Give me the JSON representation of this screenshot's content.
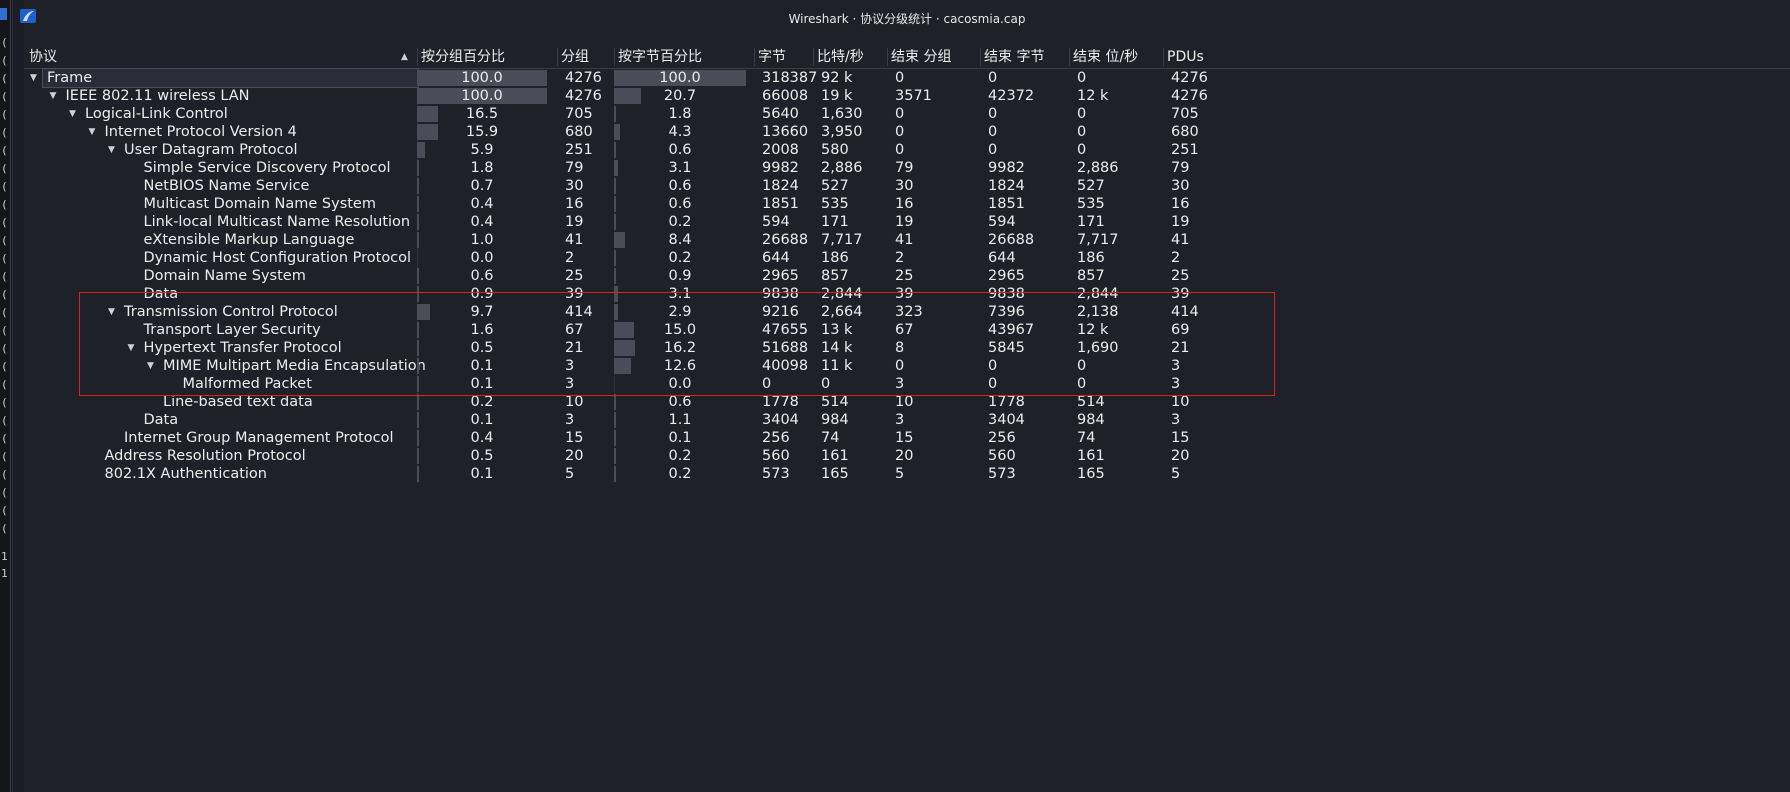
{
  "window": {
    "title": "Wireshark · 协议分级统计 · cacosmia.cap"
  },
  "left_strip": {
    "chars": [
      "(",
      "(",
      "(",
      "(",
      "(",
      "(",
      "(",
      "(",
      "(",
      "(",
      "(",
      "(",
      "(",
      "(",
      "(",
      "(",
      "(",
      "(",
      "(",
      "(",
      "(",
      "(",
      "(",
      "(",
      "(",
      "(",
      "(",
      "(",
      "1",
      "1"
    ]
  },
  "columns": [
    "协议",
    "按分组百分比",
    "分组",
    "按字节百分比",
    "字节",
    "比特/秒",
    "结束 分组",
    "结束 字节",
    "结束 位/秒",
    "PDUs"
  ],
  "rows": [
    {
      "depth": 0,
      "expanded": true,
      "protocol": "Frame",
      "pkt_pct": "100.0",
      "pkts": "4276",
      "byte_pct": "100.0",
      "bytes": "318387",
      "bps": "92 k",
      "end_pkts": "0",
      "end_bytes": "0",
      "end_bps": "0",
      "pdus": "4276",
      "pkt_frac": 1.0,
      "byte_frac": 1.0,
      "selected": true
    },
    {
      "depth": 1,
      "expanded": true,
      "protocol": "IEEE 802.11 wireless LAN",
      "pkt_pct": "100.0",
      "pkts": "4276",
      "byte_pct": "20.7",
      "bytes": "66008",
      "bps": "19 k",
      "end_pkts": "3571",
      "end_bytes": "42372",
      "end_bps": "12 k",
      "pdus": "4276",
      "pkt_frac": 1.0,
      "byte_frac": 0.207
    },
    {
      "depth": 2,
      "expanded": true,
      "protocol": "Logical-Link Control",
      "pkt_pct": "16.5",
      "pkts": "705",
      "byte_pct": "1.8",
      "bytes": "5640",
      "bps": "1,630",
      "end_pkts": "0",
      "end_bytes": "0",
      "end_bps": "0",
      "pdus": "705",
      "pkt_frac": 0.165,
      "byte_frac": 0.018
    },
    {
      "depth": 3,
      "expanded": true,
      "protocol": "Internet Protocol Version 4",
      "pkt_pct": "15.9",
      "pkts": "680",
      "byte_pct": "4.3",
      "bytes": "13660",
      "bps": "3,950",
      "end_pkts": "0",
      "end_bytes": "0",
      "end_bps": "0",
      "pdus": "680",
      "pkt_frac": 0.159,
      "byte_frac": 0.043
    },
    {
      "depth": 4,
      "expanded": true,
      "protocol": "User Datagram Protocol",
      "pkt_pct": "5.9",
      "pkts": "251",
      "byte_pct": "0.6",
      "bytes": "2008",
      "bps": "580",
      "end_pkts": "0",
      "end_bytes": "0",
      "end_bps": "0",
      "pdus": "251",
      "pkt_frac": 0.059,
      "byte_frac": 0.006
    },
    {
      "depth": 5,
      "protocol": "Simple Service Discovery Protocol",
      "pkt_pct": "1.8",
      "pkts": "79",
      "byte_pct": "3.1",
      "bytes": "9982",
      "bps": "2,886",
      "end_pkts": "79",
      "end_bytes": "9982",
      "end_bps": "2,886",
      "pdus": "79",
      "pkt_frac": 0.018,
      "byte_frac": 0.031
    },
    {
      "depth": 5,
      "protocol": "NetBIOS Name Service",
      "pkt_pct": "0.7",
      "pkts": "30",
      "byte_pct": "0.6",
      "bytes": "1824",
      "bps": "527",
      "end_pkts": "30",
      "end_bytes": "1824",
      "end_bps": "527",
      "pdus": "30",
      "pkt_frac": 0.007,
      "byte_frac": 0.006
    },
    {
      "depth": 5,
      "protocol": "Multicast Domain Name System",
      "pkt_pct": "0.4",
      "pkts": "16",
      "byte_pct": "0.6",
      "bytes": "1851",
      "bps": "535",
      "end_pkts": "16",
      "end_bytes": "1851",
      "end_bps": "535",
      "pdus": "16",
      "pkt_frac": 0.004,
      "byte_frac": 0.006
    },
    {
      "depth": 5,
      "protocol": "Link-local Multicast Name Resolution",
      "pkt_pct": "0.4",
      "pkts": "19",
      "byte_pct": "0.2",
      "bytes": "594",
      "bps": "171",
      "end_pkts": "19",
      "end_bytes": "594",
      "end_bps": "171",
      "pdus": "19",
      "pkt_frac": 0.004,
      "byte_frac": 0.002
    },
    {
      "depth": 5,
      "protocol": "eXtensible Markup Language",
      "pkt_pct": "1.0",
      "pkts": "41",
      "byte_pct": "8.4",
      "bytes": "26688",
      "bps": "7,717",
      "end_pkts": "41",
      "end_bytes": "26688",
      "end_bps": "7,717",
      "pdus": "41",
      "pkt_frac": 0.01,
      "byte_frac": 0.084
    },
    {
      "depth": 5,
      "protocol": "Dynamic Host Configuration Protocol",
      "pkt_pct": "0.0",
      "pkts": "2",
      "byte_pct": "0.2",
      "bytes": "644",
      "bps": "186",
      "end_pkts": "2",
      "end_bytes": "644",
      "end_bps": "186",
      "pdus": "2",
      "pkt_frac": 0.0,
      "byte_frac": 0.002
    },
    {
      "depth": 5,
      "protocol": "Domain Name System",
      "pkt_pct": "0.6",
      "pkts": "25",
      "byte_pct": "0.9",
      "bytes": "2965",
      "bps": "857",
      "end_pkts": "25",
      "end_bytes": "2965",
      "end_bps": "857",
      "pdus": "25",
      "pkt_frac": 0.006,
      "byte_frac": 0.009
    },
    {
      "depth": 5,
      "protocol": "Data",
      "pkt_pct": "0.9",
      "pkts": "39",
      "byte_pct": "3.1",
      "bytes": "9838",
      "bps": "2,844",
      "end_pkts": "39",
      "end_bytes": "9838",
      "end_bps": "2,844",
      "pdus": "39",
      "pkt_frac": 0.009,
      "byte_frac": 0.031
    },
    {
      "depth": 4,
      "expanded": true,
      "protocol": "Transmission Control Protocol",
      "pkt_pct": "9.7",
      "pkts": "414",
      "byte_pct": "2.9",
      "bytes": "9216",
      "bps": "2,664",
      "end_pkts": "323",
      "end_bytes": "7396",
      "end_bps": "2,138",
      "pdus": "414",
      "pkt_frac": 0.097,
      "byte_frac": 0.029
    },
    {
      "depth": 5,
      "protocol": "Transport Layer Security",
      "pkt_pct": "1.6",
      "pkts": "67",
      "byte_pct": "15.0",
      "bytes": "47655",
      "bps": "13 k",
      "end_pkts": "67",
      "end_bytes": "43967",
      "end_bps": "12 k",
      "pdus": "69",
      "pkt_frac": 0.016,
      "byte_frac": 0.15
    },
    {
      "depth": 5,
      "expanded": true,
      "protocol": "Hypertext Transfer Protocol",
      "pkt_pct": "0.5",
      "pkts": "21",
      "byte_pct": "16.2",
      "bytes": "51688",
      "bps": "14 k",
      "end_pkts": "8",
      "end_bytes": "5845",
      "end_bps": "1,690",
      "pdus": "21",
      "pkt_frac": 0.005,
      "byte_frac": 0.162
    },
    {
      "depth": 6,
      "expanded": true,
      "protocol": "MIME Multipart Media Encapsulation",
      "pkt_pct": "0.1",
      "pkts": "3",
      "byte_pct": "12.6",
      "bytes": "40098",
      "bps": "11 k",
      "end_pkts": "0",
      "end_bytes": "0",
      "end_bps": "0",
      "pdus": "3",
      "pkt_frac": 0.001,
      "byte_frac": 0.126
    },
    {
      "depth": 7,
      "protocol": "Malformed Packet",
      "pkt_pct": "0.1",
      "pkts": "3",
      "byte_pct": "0.0",
      "bytes": "0",
      "bps": "0",
      "end_pkts": "3",
      "end_bytes": "0",
      "end_bps": "0",
      "pdus": "3",
      "pkt_frac": 0.001,
      "byte_frac": 0.0
    },
    {
      "depth": 6,
      "protocol": "Line-based text data",
      "pkt_pct": "0.2",
      "pkts": "10",
      "byte_pct": "0.6",
      "bytes": "1778",
      "bps": "514",
      "end_pkts": "10",
      "end_bytes": "1778",
      "end_bps": "514",
      "pdus": "10",
      "pkt_frac": 0.002,
      "byte_frac": 0.006
    },
    {
      "depth": 5,
      "protocol": "Data",
      "pkt_pct": "0.1",
      "pkts": "3",
      "byte_pct": "1.1",
      "bytes": "3404",
      "bps": "984",
      "end_pkts": "3",
      "end_bytes": "3404",
      "end_bps": "984",
      "pdus": "3",
      "pkt_frac": 0.001,
      "byte_frac": 0.011
    },
    {
      "depth": 4,
      "protocol": "Internet Group Management Protocol",
      "pkt_pct": "0.4",
      "pkts": "15",
      "byte_pct": "0.1",
      "bytes": "256",
      "bps": "74",
      "end_pkts": "15",
      "end_bytes": "256",
      "end_bps": "74",
      "pdus": "15",
      "pkt_frac": 0.004,
      "byte_frac": 0.001
    },
    {
      "depth": 3,
      "protocol": "Address Resolution Protocol",
      "pkt_pct": "0.5",
      "pkts": "20",
      "byte_pct": "0.2",
      "bytes": "560",
      "bps": "161",
      "end_pkts": "20",
      "end_bytes": "560",
      "end_bps": "161",
      "pdus": "20",
      "pkt_frac": 0.005,
      "byte_frac": 0.002
    },
    {
      "depth": 3,
      "protocol": "802.1X Authentication",
      "pkt_pct": "0.1",
      "pkts": "5",
      "byte_pct": "0.2",
      "bytes": "573",
      "bps": "165",
      "end_pkts": "5",
      "end_bytes": "573",
      "end_bps": "165",
      "pdus": "5",
      "pkt_frac": 0.001,
      "byte_frac": 0.002
    }
  ],
  "colors": {
    "background": "#1f2129",
    "bar": "#4a4d57",
    "highlight": "#e02020",
    "accent": "#2f6fd6"
  }
}
